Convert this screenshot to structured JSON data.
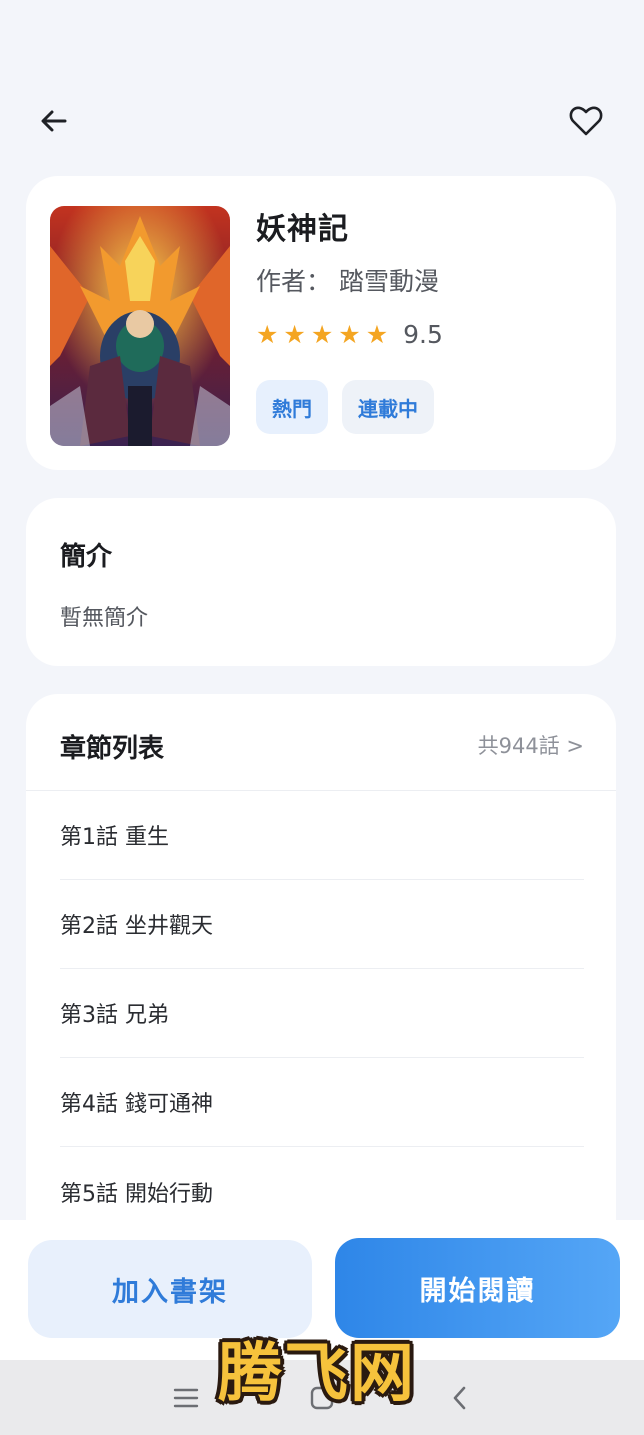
{
  "comic": {
    "title": "妖神記",
    "author": "作者：  踏雪動漫",
    "rating": 9.5,
    "rating_text": "9.5",
    "stars": 5,
    "tags": [
      "熱門",
      "連載中"
    ]
  },
  "intro": {
    "heading": "簡介",
    "text": "暫無簡介"
  },
  "chapters": {
    "heading": "章節列表",
    "count_label": "共944話  >",
    "items": [
      {
        "label": "第1話  重生"
      },
      {
        "label": "第2話  坐井觀天"
      },
      {
        "label": "第3話  兄弟"
      },
      {
        "label": "第4話  錢可通神"
      },
      {
        "label": "第5話  開始行動"
      }
    ]
  },
  "actions": {
    "add_shelf": "加入書架",
    "start_read": "開始閱讀"
  },
  "watermark": "腾飞网",
  "icons": {
    "back": "arrow-left-icon",
    "favorite": "heart-outline-icon",
    "star": "star-icon",
    "nav_menu": "menu-icon",
    "nav_home": "home-icon",
    "nav_back": "chevron-left-icon"
  },
  "colors": {
    "accent": "#2f7bd9",
    "star": "#f4a522",
    "background": "#f3f5fa"
  }
}
